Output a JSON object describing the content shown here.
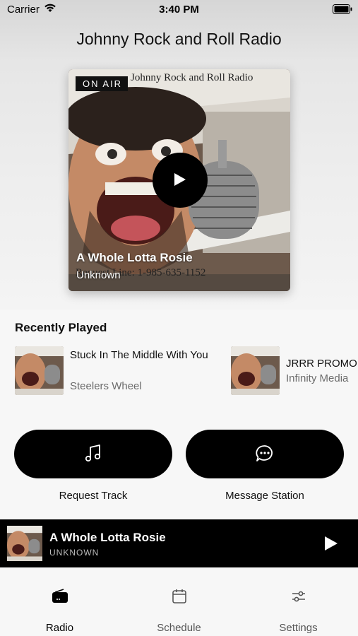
{
  "status_bar": {
    "carrier": "Carrier",
    "time": "3:40 PM"
  },
  "header": {
    "title": "Johnny Rock and Roll Radio"
  },
  "now_playing": {
    "badge": "ON AIR",
    "artwork_banner": "Johnny Rock and Roll Radio",
    "artwork_hotline": "Request Line: 1-985-635-1152",
    "title": "A Whole Lotta Rosie",
    "artist": "Unknown"
  },
  "recently_played": {
    "heading": "Recently Played",
    "items": [
      {
        "title": "Stuck In The Middle With You",
        "artist": "Steelers Wheel"
      },
      {
        "title": "JRRR PROMO",
        "artist": "Infinity Media"
      }
    ]
  },
  "actions": {
    "request_label": "Request Track",
    "message_label": "Message Station"
  },
  "mini_player": {
    "title": "A Whole Lotta Rosie",
    "artist": "UNKNOWN"
  },
  "tabs": [
    {
      "label": "Radio",
      "icon": "radio-icon",
      "active": true
    },
    {
      "label": "Schedule",
      "icon": "calendar-icon",
      "active": false
    },
    {
      "label": "Settings",
      "icon": "sliders-icon",
      "active": false
    }
  ],
  "colors": {
    "accent": "#000000",
    "inactive_tab": "#555555",
    "secondary_text": "#6b6b6b"
  }
}
